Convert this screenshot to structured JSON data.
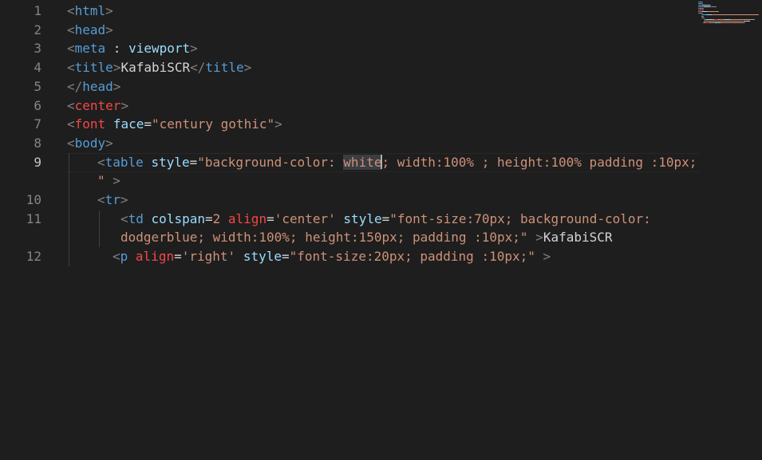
{
  "editor": {
    "line_numbers": [
      "1",
      "2",
      "3",
      "4",
      "5",
      "6",
      "7",
      "8",
      "9",
      "",
      "10",
      "11",
      "",
      "12"
    ],
    "active_line": "9",
    "lines": [
      {
        "num": "1",
        "tokens": [
          {
            "t": "<",
            "c": "punc"
          },
          {
            "t": "html",
            "c": "tag"
          },
          {
            "t": ">",
            "c": "punc"
          }
        ]
      },
      {
        "num": "2",
        "tokens": [
          {
            "t": "<",
            "c": "punc"
          },
          {
            "t": "head",
            "c": "tag"
          },
          {
            "t": ">",
            "c": "punc"
          }
        ]
      },
      {
        "num": "3",
        "tokens": [
          {
            "t": "<",
            "c": "punc"
          },
          {
            "t": "meta",
            "c": "tag"
          },
          {
            "t": " : ",
            "c": "txt"
          },
          {
            "t": "viewport",
            "c": "attr"
          },
          {
            "t": ">",
            "c": "punc"
          }
        ]
      },
      {
        "num": "4",
        "tokens": [
          {
            "t": "<",
            "c": "punc"
          },
          {
            "t": "title",
            "c": "tag"
          },
          {
            "t": ">",
            "c": "punc"
          },
          {
            "t": "KafabiSCR",
            "c": "txt"
          },
          {
            "t": "</",
            "c": "punc"
          },
          {
            "t": "title",
            "c": "tag"
          },
          {
            "t": ">",
            "c": "punc"
          }
        ]
      },
      {
        "num": "5",
        "tokens": [
          {
            "t": "</",
            "c": "punc"
          },
          {
            "t": "head",
            "c": "tag"
          },
          {
            "t": ">",
            "c": "punc"
          }
        ]
      },
      {
        "num": "6",
        "tokens": [
          {
            "t": "<",
            "c": "punc"
          },
          {
            "t": "center",
            "c": "red"
          },
          {
            "t": ">",
            "c": "punc"
          }
        ]
      },
      {
        "num": "7",
        "tokens": [
          {
            "t": "<",
            "c": "punc"
          },
          {
            "t": "font",
            "c": "red"
          },
          {
            "t": " ",
            "c": "txt"
          },
          {
            "t": "face",
            "c": "attr"
          },
          {
            "t": "=",
            "c": "txt"
          },
          {
            "t": "\"century gothic\"",
            "c": "str"
          },
          {
            "t": ">",
            "c": "punc"
          }
        ]
      },
      {
        "num": "8",
        "tokens": [
          {
            "t": "<",
            "c": "punc"
          },
          {
            "t": "body",
            "c": "tag"
          },
          {
            "t": ">",
            "c": "punc"
          }
        ]
      },
      {
        "num": "9",
        "tokens": [
          {
            "t": "<",
            "c": "punc"
          },
          {
            "t": "table",
            "c": "tag"
          },
          {
            "t": " ",
            "c": "txt"
          },
          {
            "t": "style",
            "c": "attr"
          },
          {
            "t": "=",
            "c": "txt"
          },
          {
            "t": "\"background-color: ",
            "c": "str"
          },
          {
            "t": "white",
            "c": "str hl"
          },
          {
            "t": "|",
            "c": "cursor"
          },
          {
            "t": "; width:100% ; height:100% padding :10px;",
            "c": "str"
          }
        ]
      },
      {
        "num": "",
        "tokens": [
          {
            "t": "\" ",
            "c": "str"
          },
          {
            "t": ">",
            "c": "punc"
          }
        ]
      },
      {
        "num": "10",
        "tokens": [
          {
            "t": "<",
            "c": "punc"
          },
          {
            "t": "tr",
            "c": "tag"
          },
          {
            "t": ">",
            "c": "punc"
          }
        ]
      },
      {
        "num": "11",
        "tokens": [
          {
            "t": "<",
            "c": "punc"
          },
          {
            "t": "td",
            "c": "tag"
          },
          {
            "t": " ",
            "c": "txt"
          },
          {
            "t": "colspan",
            "c": "attr"
          },
          {
            "t": "=",
            "c": "txt"
          },
          {
            "t": "2",
            "c": "str"
          },
          {
            "t": " ",
            "c": "txt"
          },
          {
            "t": "align",
            "c": "red"
          },
          {
            "t": "=",
            "c": "txt"
          },
          {
            "t": "'center'",
            "c": "str"
          },
          {
            "t": " ",
            "c": "txt"
          },
          {
            "t": "style",
            "c": "attr"
          },
          {
            "t": "=",
            "c": "txt"
          },
          {
            "t": "\"font-size:70px; background-color:",
            "c": "str"
          }
        ]
      },
      {
        "num": "",
        "tokens": [
          {
            "t": "dodgerblue; width:100%; height:150px; padding :10px;\"",
            "c": "str"
          },
          {
            "t": " >",
            "c": "punc"
          },
          {
            "t": "KafabiSCR",
            "c": "txt"
          }
        ]
      },
      {
        "num": "12",
        "tokens": [
          {
            "t": "<",
            "c": "punc"
          },
          {
            "t": "p",
            "c": "tag"
          },
          {
            "t": " ",
            "c": "txt"
          },
          {
            "t": "align",
            "c": "red"
          },
          {
            "t": "=",
            "c": "txt"
          },
          {
            "t": "'right'",
            "c": "str"
          },
          {
            "t": " ",
            "c": "txt"
          },
          {
            "t": "style",
            "c": "attr"
          },
          {
            "t": "=",
            "c": "txt"
          },
          {
            "t": "\"font-size:20px; padding :10px;\"",
            "c": "str"
          },
          {
            "t": " >",
            "c": "punc"
          }
        ]
      }
    ]
  },
  "colors": {
    "background": "#1e1e1e",
    "tag": "#569cd6",
    "attribute": "#9cdcfe",
    "string": "#ce9178",
    "deprecated": "#f44747",
    "punctuation": "#808080",
    "line_number": "#858585"
  }
}
